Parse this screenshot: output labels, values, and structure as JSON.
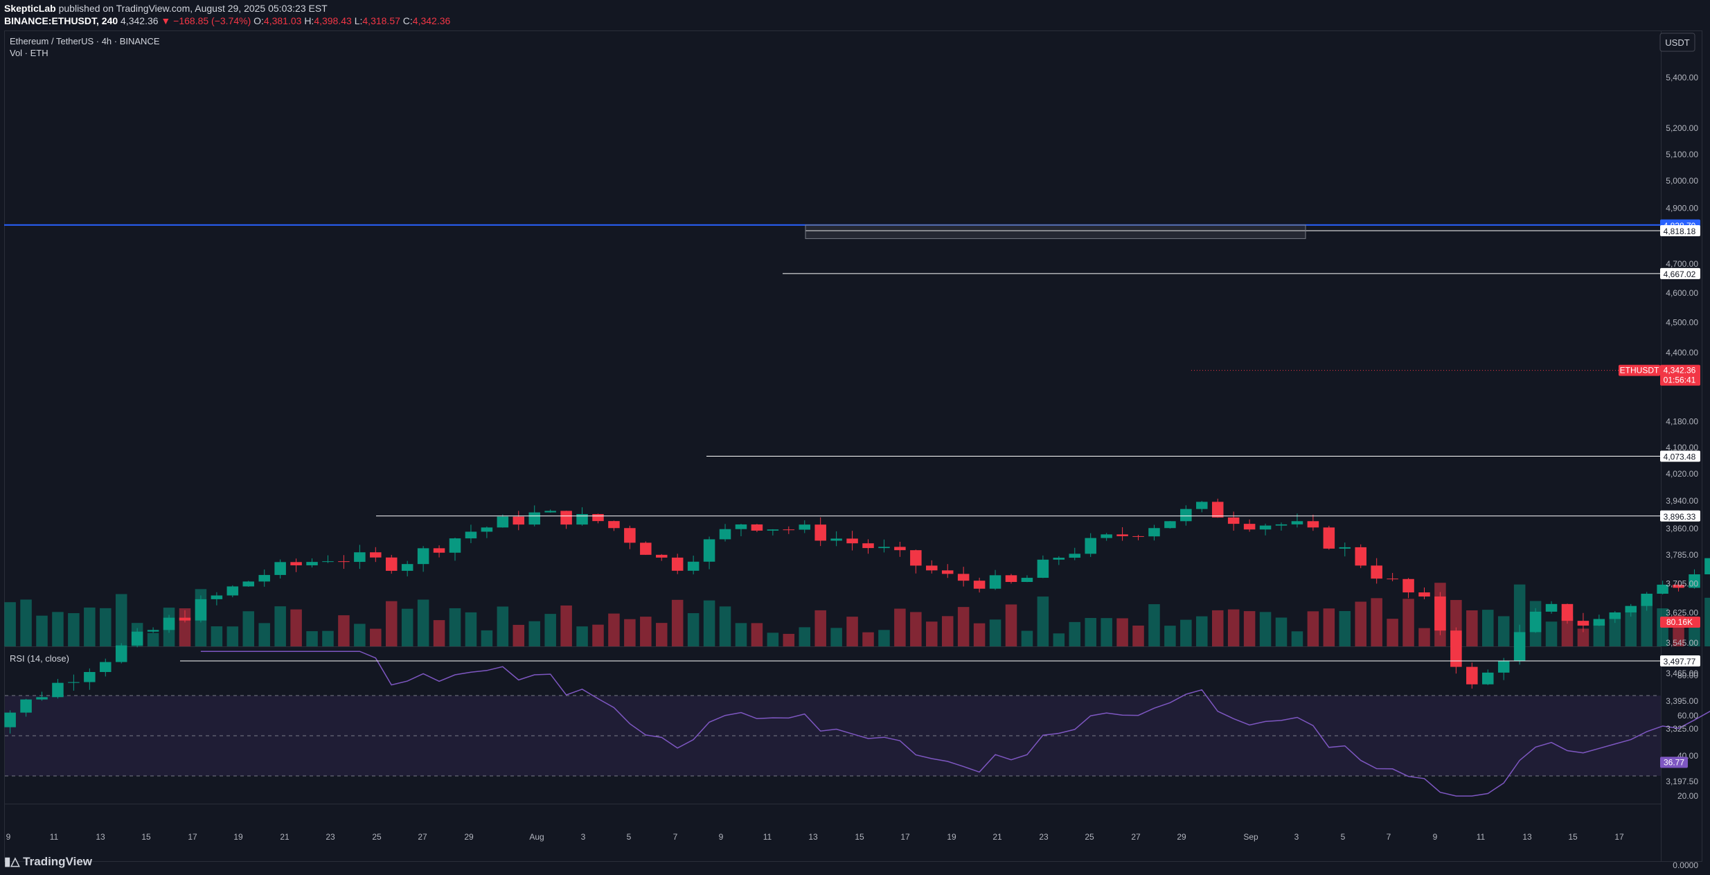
{
  "header": {
    "author": "SkepticLab",
    "published_text": "published on TradingView.com, August 29, 2025 05:03:23 EST",
    "symbol_interval": "BINANCE:ETHUSDT, 240",
    "last": "4,342.36",
    "change": "▼ −168.85 (−3.74%)",
    "o_label": "O:",
    "o_value": "4,381.03",
    "h_label": "H:",
    "h_value": "4,398.43",
    "l_label": "L:",
    "l_value": "4,318.57",
    "c_label": "C:",
    "c_value": "4,342.36"
  },
  "legend": {
    "title": "Ethereum / TetherUS · 4h · BINANCE",
    "volume": "Vol · ETH",
    "rsi": "RSI (14, close)"
  },
  "currency_button": "USDT",
  "footer": {
    "logo_text": "TradingView"
  },
  "colors": {
    "background": "#131722",
    "up": "#089981",
    "down": "#f23645",
    "level_line": "#ffffff",
    "resistance_line": "#2962ff",
    "rsi_line": "#7e57c2",
    "rsi_band": "#1f1d35"
  },
  "chart_data": [
    {
      "type": "candlestick",
      "title": "Ethereum / TetherUS · 4h · BINANCE",
      "ylabel": "USDT",
      "price_scale": "log",
      "ylim": [
        3197.5,
        5520
      ],
      "x_ticks": [
        "9",
        "11",
        "13",
        "15",
        "17",
        "19",
        "21",
        "23",
        "25",
        "27",
        "29",
        "Aug",
        "3",
        "5",
        "7",
        "9",
        "11",
        "13",
        "15",
        "17",
        "19",
        "21",
        "23",
        "25",
        "27",
        "29",
        "Sep",
        "3",
        "5",
        "7",
        "9",
        "11",
        "13",
        "15",
        "17"
      ],
      "y_ticks": [
        "5,400.00",
        "5,200.00",
        "5,100.00",
        "5,000.00",
        "4,900.00",
        "4,700.00",
        "4,600.00",
        "4,500.00",
        "4,400.00",
        "4,180.00",
        "4,100.00",
        "4,020.00",
        "3,940.00",
        "3,860.00",
        "3,785.00",
        "3,705.00",
        "3,625.00",
        "3,545.00",
        "3,465.00",
        "3,395.00",
        "3,325.00",
        "3,197.50"
      ],
      "y_tick_values": [
        5400,
        5200,
        5100,
        5000,
        4900,
        4700,
        4600,
        4500,
        4400,
        4180,
        4100,
        4020,
        3940,
        3860,
        3785,
        3705,
        3625,
        3545,
        3465,
        3395,
        3325,
        3197.5
      ],
      "horizontal_levels": [
        {
          "label": "4,838.79",
          "value": 4838.79,
          "style": "blue"
        },
        {
          "label": "4,818.18",
          "value": 4818.18,
          "style": "white"
        },
        {
          "label": "4,667.02",
          "value": 4667.02,
          "style": "white"
        },
        {
          "label": "4,073.48",
          "value": 4073.48,
          "style": "white"
        },
        {
          "label": "3,896.33",
          "value": 3896.33,
          "style": "white"
        },
        {
          "label": "3,497.77",
          "value": 3497.77,
          "style": "white"
        }
      ],
      "resistance_zone": [
        4790,
        4838.79
      ],
      "symbol_tag": "ETHUSDT",
      "last_price_label": "4,342.36",
      "last_price": 4342.36,
      "countdown": "01:56:41",
      "volume_label": "80.16K",
      "price_anchors": [
        [
          7,
          3300
        ],
        [
          16,
          3600
        ],
        [
          20,
          3730
        ],
        [
          23,
          3780
        ],
        [
          26,
          3760
        ],
        [
          29,
          3850
        ],
        [
          32,
          3900
        ],
        [
          35,
          3880
        ],
        [
          38,
          3750
        ],
        [
          41,
          3880
        ],
        [
          44,
          3850
        ],
        [
          47,
          3800
        ],
        [
          50,
          3720
        ],
        [
          53,
          3700
        ],
        [
          55,
          3790
        ],
        [
          58,
          3850
        ],
        [
          61,
          3920
        ],
        [
          63,
          3880
        ],
        [
          65,
          3870
        ],
        [
          67,
          3810
        ],
        [
          69,
          3720
        ],
        [
          71,
          3640
        ],
        [
          72,
          3520
        ],
        [
          72.7,
          3420
        ],
        [
          73.5,
          3460
        ],
        [
          76,
          3640
        ],
        [
          78,
          3590
        ],
        [
          80,
          3660
        ],
        [
          82,
          3720
        ],
        [
          84,
          3840
        ],
        [
          86,
          4020
        ],
        [
          88,
          4120
        ],
        [
          90,
          4180
        ],
        [
          92,
          4230
        ],
        [
          94,
          4320
        ],
        [
          95.5,
          4470
        ],
        [
          97,
          4620
        ],
        [
          98,
          4700
        ],
        [
          99,
          4810
        ],
        [
          100,
          4660
        ],
        [
          102,
          4580
        ],
        [
          103,
          4430
        ],
        [
          105,
          4470
        ],
        [
          106.5,
          4560
        ],
        [
          108,
          4400
        ],
        [
          109.5,
          4240
        ],
        [
          111,
          4150
        ],
        [
          112,
          4080
        ],
        [
          114,
          4300
        ],
        [
          116,
          4370
        ],
        [
          118,
          4250
        ],
        [
          119.5,
          4270
        ],
        [
          120.5,
          4740
        ],
        [
          121.5,
          4800
        ],
        [
          123,
          4740
        ],
        [
          125,
          4780
        ],
        [
          127,
          4700
        ],
        [
          128,
          4510
        ],
        [
          129.5,
          4400
        ],
        [
          131,
          4580
        ],
        [
          133,
          4640
        ],
        [
          134,
          4600
        ],
        [
          135,
          4640
        ],
        [
          136.5,
          4480
        ],
        [
          138,
          4342
        ]
      ],
      "x_range": [
        5.8,
        168
      ],
      "candle_count": 190,
      "rsi": {
        "ylim": [
          0,
          100
        ],
        "y_ticks": [
          "80.00",
          "60.00",
          "40.00",
          "20.00",
          "0.0000"
        ],
        "y_tick_values": [
          80,
          60,
          40,
          20,
          0
        ],
        "band": [
          30,
          70
        ],
        "midline": 50,
        "current_label": "36.77",
        "current": 36.77
      }
    }
  ]
}
